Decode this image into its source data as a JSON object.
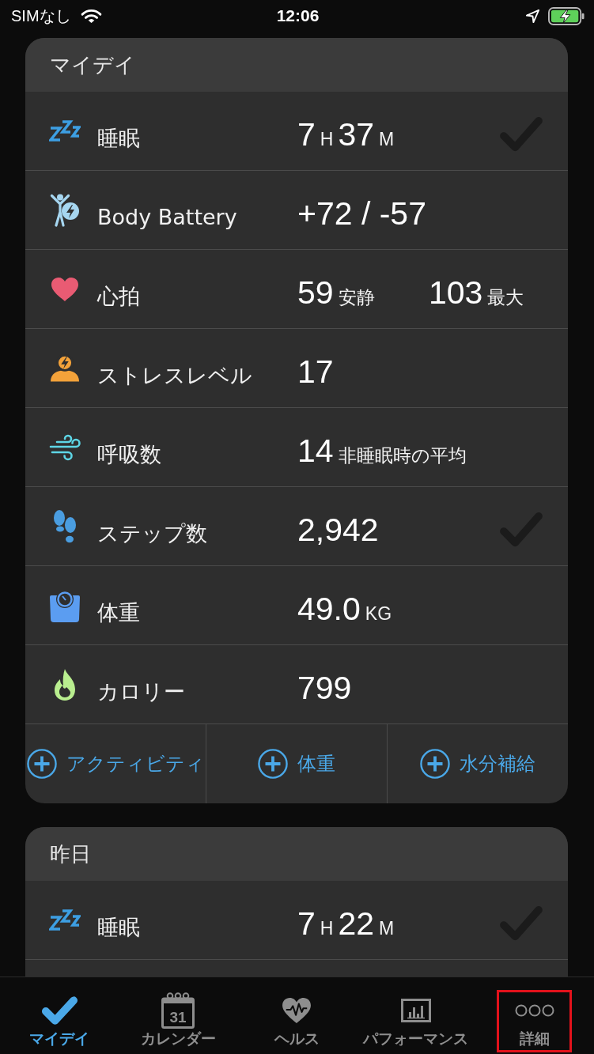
{
  "status_bar": {
    "carrier": "SIMなし",
    "time": "12:06"
  },
  "cards": [
    {
      "title": "マイデイ",
      "metrics": [
        {
          "kind": "sleep",
          "label": "睡眠",
          "readings": [
            {
              "parts": [
                {
                  "text": "7",
                  "kind": "number"
                },
                {
                  "text": "H",
                  "kind": "unit"
                },
                {
                  "text": "37",
                  "kind": "number"
                },
                {
                  "text": "M",
                  "kind": "unit"
                }
              ]
            }
          ],
          "checked": true
        },
        {
          "kind": "body_battery",
          "label": "Body Battery",
          "readings": [
            {
              "parts": [
                {
                  "text": "+72 / -57",
                  "kind": "number"
                }
              ]
            }
          ],
          "checked": false
        },
        {
          "kind": "heart_rate",
          "label": "心拍",
          "readings": [
            {
              "parts": [
                {
                  "text": "59",
                  "kind": "number"
                },
                {
                  "text": "安静",
                  "kind": "unit"
                }
              ]
            },
            {
              "parts": [
                {
                  "text": "103",
                  "kind": "number"
                },
                {
                  "text": "最大",
                  "kind": "unit"
                }
              ]
            }
          ],
          "checked": false
        },
        {
          "kind": "stress",
          "label": "ストレスレベル",
          "readings": [
            {
              "parts": [
                {
                  "text": "17",
                  "kind": "number"
                }
              ]
            }
          ],
          "checked": false
        },
        {
          "kind": "respiration",
          "label": "呼吸数",
          "readings": [
            {
              "parts": [
                {
                  "text": "14",
                  "kind": "number"
                },
                {
                  "text": "非睡眠時の平均",
                  "kind": "unit"
                }
              ]
            }
          ],
          "checked": false
        },
        {
          "kind": "steps",
          "label": "ステップ数",
          "readings": [
            {
              "parts": [
                {
                  "text": "2,942",
                  "kind": "number"
                }
              ]
            }
          ],
          "checked": true
        },
        {
          "kind": "weight",
          "label": "体重",
          "readings": [
            {
              "parts": [
                {
                  "text": "49.0",
                  "kind": "number"
                },
                {
                  "text": "KG",
                  "kind": "unit"
                }
              ]
            }
          ],
          "checked": false
        },
        {
          "kind": "calories",
          "label": "カロリー",
          "readings": [
            {
              "parts": [
                {
                  "text": "799",
                  "kind": "number"
                }
              ]
            }
          ],
          "checked": false
        }
      ],
      "actions": [
        {
          "label": "アクティビティ"
        },
        {
          "label": "体重"
        },
        {
          "label": "水分補給"
        }
      ]
    },
    {
      "title": "昨日",
      "metrics": [
        {
          "kind": "sleep",
          "label": "睡眠",
          "readings": [
            {
              "parts": [
                {
                  "text": "7",
                  "kind": "number"
                },
                {
                  "text": "H",
                  "kind": "unit"
                },
                {
                  "text": "22",
                  "kind": "number"
                },
                {
                  "text": "M",
                  "kind": "unit"
                }
              ]
            }
          ],
          "checked": true
        }
      ]
    }
  ],
  "tab_bar": {
    "tabs": [
      {
        "kind": "my_day",
        "label": "マイデイ",
        "selected": true,
        "highlighted": false
      },
      {
        "kind": "calendar",
        "label": "カレンダー",
        "calendar_day": "31",
        "selected": false,
        "highlighted": false
      },
      {
        "kind": "health",
        "label": "ヘルス",
        "selected": false,
        "highlighted": false
      },
      {
        "kind": "performance",
        "label": "パフォーマンス",
        "selected": false,
        "highlighted": false
      },
      {
        "kind": "more",
        "label": "詳細",
        "selected": false,
        "highlighted": true
      }
    ]
  }
}
